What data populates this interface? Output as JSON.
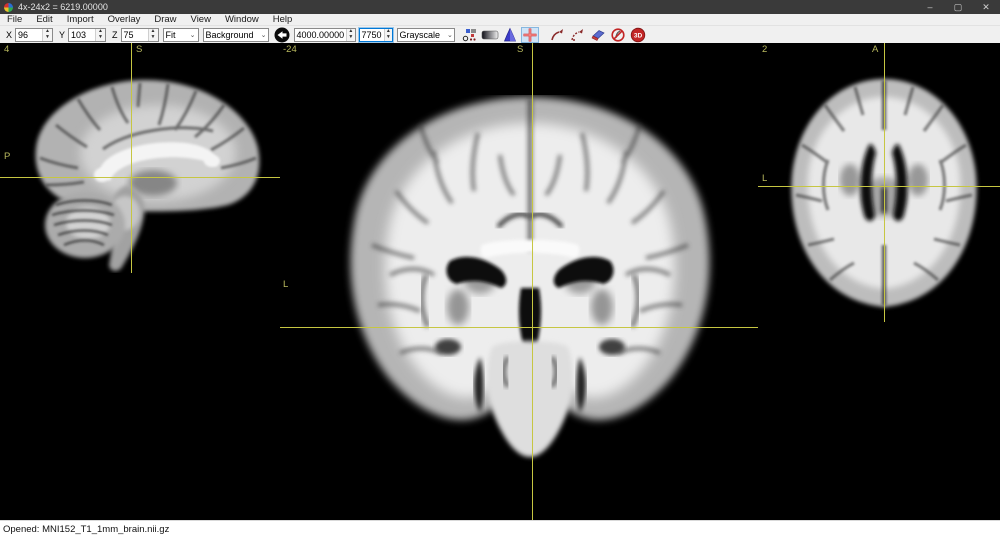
{
  "window": {
    "title": "4x-24x2 = 6219.00000",
    "minimize_glyph": "–",
    "maximize_glyph": "▢",
    "close_glyph": "✕"
  },
  "menu": {
    "items": [
      "File",
      "Edit",
      "Import",
      "Overlay",
      "Draw",
      "View",
      "Window",
      "Help"
    ]
  },
  "toolbar": {
    "coord": {
      "x_label": "X",
      "x_value": "96",
      "y_label": "Y",
      "y_value": "103",
      "z_label": "Z",
      "z_value": "75"
    },
    "zoom": {
      "value": "Fit"
    },
    "layer": {
      "value": "Background"
    },
    "contrast": {
      "min": "4000.00000",
      "max": "7750"
    },
    "colormap": {
      "value": "Grayscale"
    },
    "icons": [
      "palette",
      "intensity-gradient",
      "histogram",
      "crosshair-toggle",
      "draw-pen",
      "draw-pen-filled",
      "eraser",
      "no-draw",
      "render-3d"
    ]
  },
  "panels": {
    "sagittal": {
      "slice": "4",
      "orient_top": "S",
      "orient_side": "P"
    },
    "coronal": {
      "slice": "-24",
      "orient_top": "S",
      "orient_side": "L"
    },
    "axial": {
      "slice": "2",
      "orient_top": "A",
      "orient_side": "L"
    }
  },
  "status": {
    "text": "Opened: MNI152_T1_1mm_brain.nii.gz"
  },
  "colors": {
    "crosshair": "#c6c642",
    "orientation_label": "#b9b95e",
    "titlebar": "#3a3a3a",
    "toolbar_bg": "#f0f0f0",
    "focus_border": "#0078d7",
    "canvas": "#000000"
  }
}
